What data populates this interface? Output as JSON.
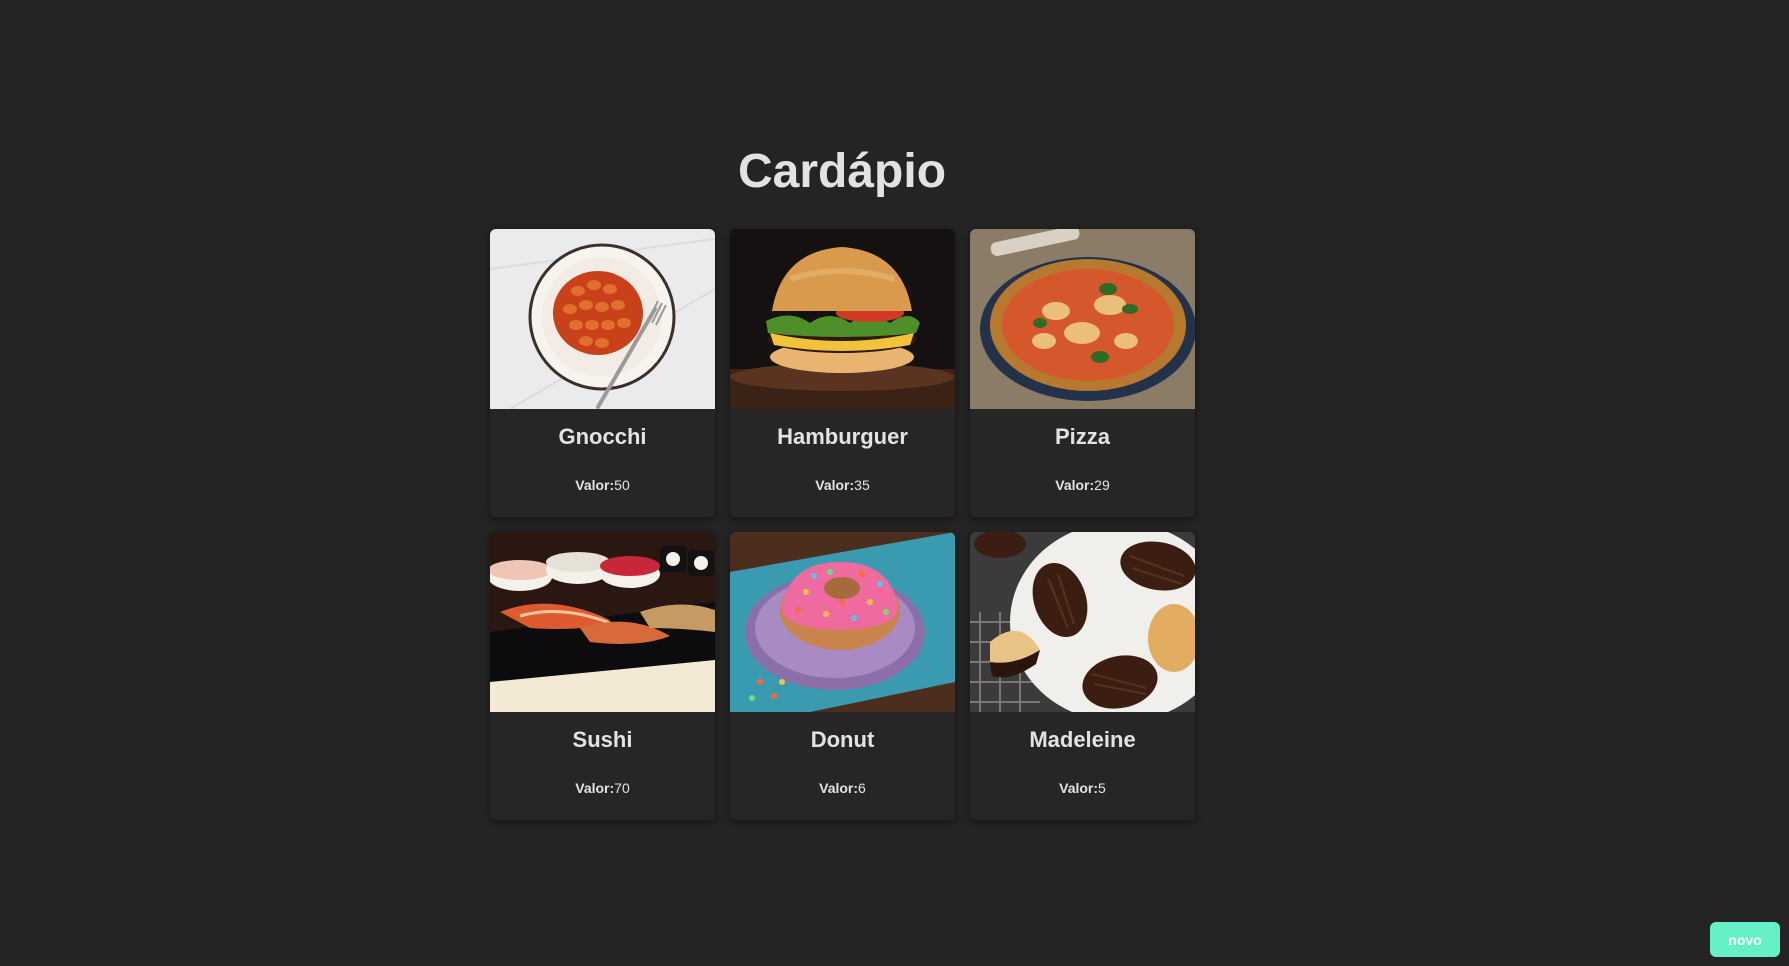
{
  "page": {
    "title": "Cardápio"
  },
  "menu": {
    "price_label": "Valor:",
    "items": [
      {
        "name": "Gnocchi",
        "price": "50",
        "image_icon": "gnocchi-plate-image"
      },
      {
        "name": "Hamburguer",
        "price": "35",
        "image_icon": "hamburger-image"
      },
      {
        "name": "Pizza",
        "price": "29",
        "image_icon": "pizza-image"
      },
      {
        "name": "Sushi",
        "price": "70",
        "image_icon": "sushi-image"
      },
      {
        "name": "Donut",
        "price": "6",
        "image_icon": "donut-image"
      },
      {
        "name": "Madeleine",
        "price": "5",
        "image_icon": "madeleine-image"
      }
    ]
  },
  "actions": {
    "new_label": "novo"
  },
  "colors": {
    "background": "#242424",
    "card": "#262626",
    "accent": "#66f0c8"
  }
}
